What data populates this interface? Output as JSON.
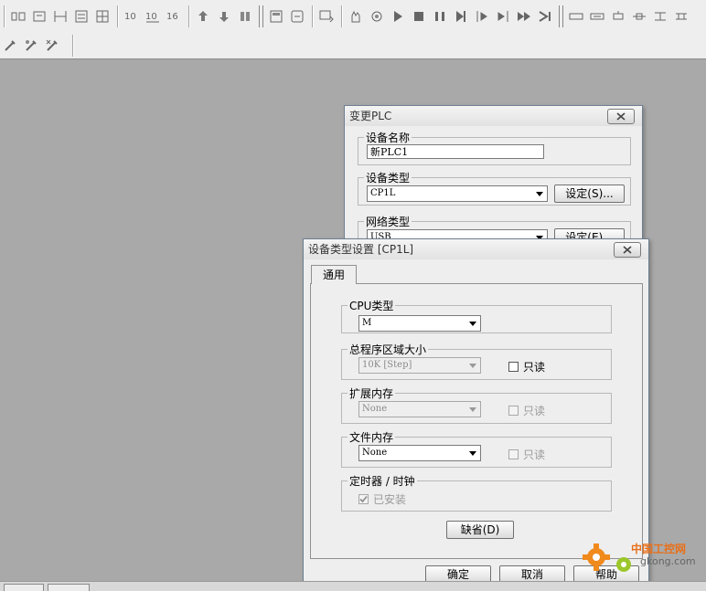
{
  "outer_dialog": {
    "title": "变更PLC",
    "device_name": {
      "label": "设备名称",
      "value": "新PLC1"
    },
    "device_type": {
      "label": "设备类型",
      "value": "CP1L",
      "settings_button": "设定(S)..."
    },
    "network_type": {
      "label": "网络类型",
      "value": "USB",
      "settings_button": "设定(E)..."
    }
  },
  "settings_dialog": {
    "title": "设备类型设置 [CP1L]",
    "tab": "通用",
    "cpu_type": {
      "label": "CPU类型",
      "value": "M"
    },
    "program_area": {
      "label": "总程序区域大小",
      "value": "10K [Step]",
      "readonly_label": "只读"
    },
    "ext_memory": {
      "label": "扩展内存",
      "value": "None",
      "readonly_label": "只读"
    },
    "file_memory": {
      "label": "文件内存",
      "value": "None",
      "readonly_label": "只读"
    },
    "timer_clock": {
      "label": "定时器 / 时钟",
      "installed_label": "已安装"
    },
    "default_button": "缺省(D)",
    "ok_button": "确定",
    "cancel_button": "取消",
    "help_button": "帮助"
  },
  "watermark": {
    "text_top": "中国工控网",
    "text_bottom": "gkong.com"
  },
  "colors": {
    "workspace": "#a9a9a9",
    "dialog_bg": "#eeeeee",
    "watermark_orange": "#f08a1c"
  }
}
